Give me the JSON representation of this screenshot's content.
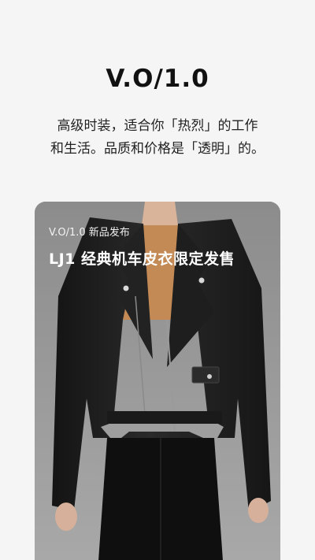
{
  "brand": {
    "title": "V.O/1.0"
  },
  "tagline": {
    "line1": "高级时装，适合你「热烈」的工作",
    "line2": "和生活。品质和价格是「透明」的。"
  },
  "hero": {
    "subtitle": "V.O/1.0 新品发布",
    "title": "LJ1 经典机车皮衣限定发售",
    "image": "model-wearing-black-leather-moto-jacket"
  },
  "colors": {
    "background": "#f5f5f5",
    "text": "#1a1a1a",
    "jacket": "#1c1c1c",
    "top": "#c8905a"
  }
}
